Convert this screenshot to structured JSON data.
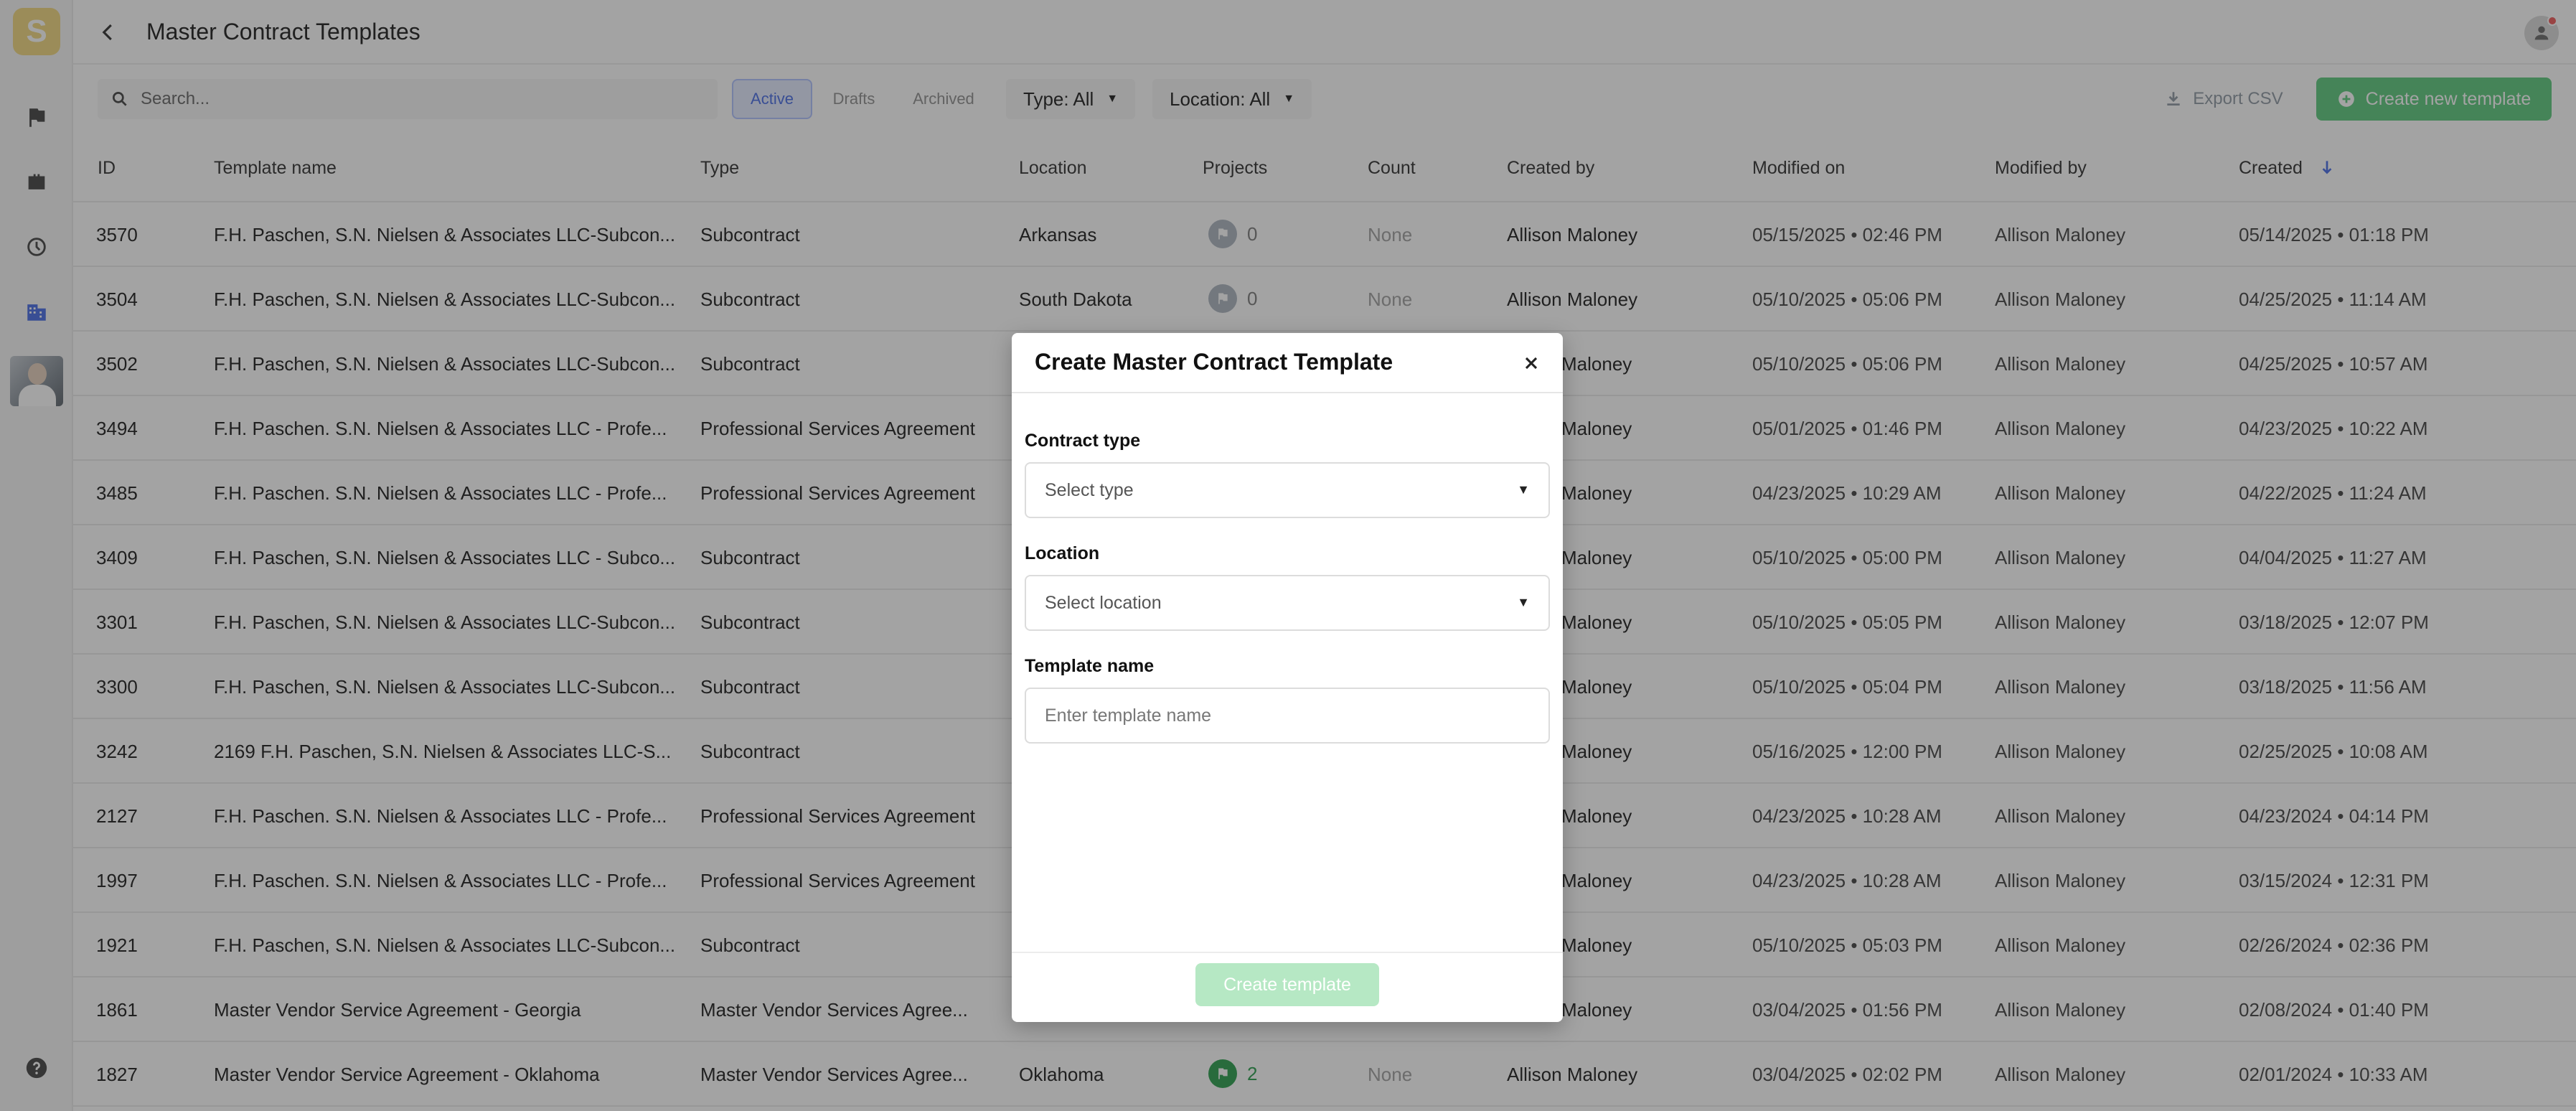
{
  "header": {
    "title": "Master Contract Templates"
  },
  "sidebar": {
    "logo": "S"
  },
  "toolbar": {
    "search_placeholder": "Search...",
    "segments": [
      "Active",
      "Drafts",
      "Archived"
    ],
    "type_filter": "Type: All",
    "location_filter": "Location: All",
    "export_label": "Export CSV",
    "create_label": "Create new template"
  },
  "table": {
    "columns": [
      "ID",
      "Template name",
      "Type",
      "Location",
      "Projects",
      "Count",
      "Created by",
      "Modified on",
      "Modified by",
      "Created"
    ],
    "rows": [
      {
        "id": "3570",
        "name": "F.H. Paschen, S.N. Nielsen & Associates LLC-Subcon...",
        "type": "Subcontract",
        "location": "Arkansas",
        "projects": "0",
        "count": "None",
        "created_by": "Allison Maloney",
        "modified_on": "05/15/2025 • 02:46 PM",
        "modified_by": "Allison Maloney",
        "created": "05/14/2025 • 01:18 PM"
      },
      {
        "id": "3504",
        "name": "F.H. Paschen, S.N. Nielsen & Associates LLC-Subcon...",
        "type": "Subcontract",
        "location": "South Dakota",
        "projects": "0",
        "count": "None",
        "created_by": "Allison Maloney",
        "modified_on": "05/10/2025 • 05:06 PM",
        "modified_by": "Allison Maloney",
        "created": "04/25/2025 • 11:14 AM"
      },
      {
        "id": "3502",
        "name": "F.H. Paschen, S.N. Nielsen & Associates LLC-Subcon...",
        "type": "Subcontract",
        "location": "",
        "projects": "",
        "count": "",
        "created_by": "Maloney",
        "modified_on": "05/10/2025 • 05:06 PM",
        "modified_by": "Allison Maloney",
        "created": "04/25/2025 • 10:57 AM"
      },
      {
        "id": "3494",
        "name": "F.H. Paschen. S.N. Nielsen & Associates LLC - Profe...",
        "type": "Professional Services Agreement",
        "location": "",
        "projects": "",
        "count": "",
        "created_by": "Maloney",
        "modified_on": "05/01/2025 • 01:46 PM",
        "modified_by": "Allison Maloney",
        "created": "04/23/2025 • 10:22 AM"
      },
      {
        "id": "3485",
        "name": "F.H. Paschen. S.N. Nielsen & Associates LLC - Profe...",
        "type": "Professional Services Agreement",
        "location": "",
        "projects": "",
        "count": "",
        "created_by": "Maloney",
        "modified_on": "04/23/2025 • 10:29 AM",
        "modified_by": "Allison Maloney",
        "created": "04/22/2025 • 11:24 AM"
      },
      {
        "id": "3409",
        "name": "F.H. Paschen, S.N. Nielsen & Associates LLC - Subco...",
        "type": "Subcontract",
        "location": "",
        "projects": "",
        "count": "",
        "created_by": "Maloney",
        "modified_on": "05/10/2025 • 05:00 PM",
        "modified_by": "Allison Maloney",
        "created": "04/04/2025 • 11:27 AM"
      },
      {
        "id": "3301",
        "name": "F.H. Paschen, S.N. Nielsen & Associates LLC-Subcon...",
        "type": "Subcontract",
        "location": "",
        "projects": "",
        "count": "",
        "created_by": "Maloney",
        "modified_on": "05/10/2025 • 05:05 PM",
        "modified_by": "Allison Maloney",
        "created": "03/18/2025 • 12:07 PM"
      },
      {
        "id": "3300",
        "name": "F.H. Paschen, S.N. Nielsen & Associates LLC-Subcon...",
        "type": "Subcontract",
        "location": "",
        "projects": "",
        "count": "",
        "created_by": "Maloney",
        "modified_on": "05/10/2025 • 05:04 PM",
        "modified_by": "Allison Maloney",
        "created": "03/18/2025 • 11:56 AM"
      },
      {
        "id": "3242",
        "name": "2169 F.H. Paschen, S.N. Nielsen & Associates LLC-S...",
        "type": "Subcontract",
        "location": "",
        "projects": "",
        "count": "",
        "created_by": "Maloney",
        "modified_on": "05/16/2025 • 12:00 PM",
        "modified_by": "Allison Maloney",
        "created": "02/25/2025 • 10:08 AM"
      },
      {
        "id": "2127",
        "name": "F.H. Paschen. S.N. Nielsen & Associates LLC - Profe...",
        "type": "Professional Services Agreement",
        "location": "",
        "projects": "",
        "count": "",
        "created_by": "Maloney",
        "modified_on": "04/23/2025 • 10:28 AM",
        "modified_by": "Allison Maloney",
        "created": "04/23/2024 • 04:14 PM"
      },
      {
        "id": "1997",
        "name": "F.H. Paschen. S.N. Nielsen & Associates LLC - Profe...",
        "type": "Professional Services Agreement",
        "location": "",
        "projects": "",
        "count": "",
        "created_by": "Maloney",
        "modified_on": "04/23/2025 • 10:28 AM",
        "modified_by": "Allison Maloney",
        "created": "03/15/2024 • 12:31 PM"
      },
      {
        "id": "1921",
        "name": "F.H. Paschen, S.N. Nielsen & Associates LLC-Subcon...",
        "type": "Subcontract",
        "location": "",
        "projects": "",
        "count": "",
        "created_by": "Maloney",
        "modified_on": "05/10/2025 • 05:03 PM",
        "modified_by": "Allison Maloney",
        "created": "02/26/2024 • 02:36 PM"
      },
      {
        "id": "1861",
        "name": "Master Vendor Service Agreement - Georgia",
        "type": "Master Vendor Services Agree...",
        "location": "",
        "projects": "",
        "count": "",
        "created_by": "Maloney",
        "modified_on": "03/04/2025 • 01:56 PM",
        "modified_by": "Allison Maloney",
        "created": "02/08/2024 • 01:40 PM"
      },
      {
        "id": "1827",
        "name": "Master Vendor Service Agreement - Oklahoma",
        "type": "Master Vendor Services Agree...",
        "location": "Oklahoma",
        "projects": "2",
        "count": "None",
        "created_by": "Allison Maloney",
        "modified_on": "03/04/2025 • 02:02 PM",
        "modified_by": "Allison Maloney",
        "created": "02/01/2024 • 10:33 AM"
      }
    ]
  },
  "modal": {
    "title": "Create Master Contract Template",
    "contract_type_label": "Contract type",
    "contract_type_placeholder": "Select type",
    "location_label": "Location",
    "location_placeholder": "Select location",
    "template_name_label": "Template name",
    "template_name_placeholder": "Enter template name",
    "submit_label": "Create template"
  },
  "colors": {
    "brand": "#f2dc8c",
    "primary_green": "#6ccf8a",
    "disabled_green": "#b6e8c4",
    "active_blue": "#5a7ae8"
  }
}
